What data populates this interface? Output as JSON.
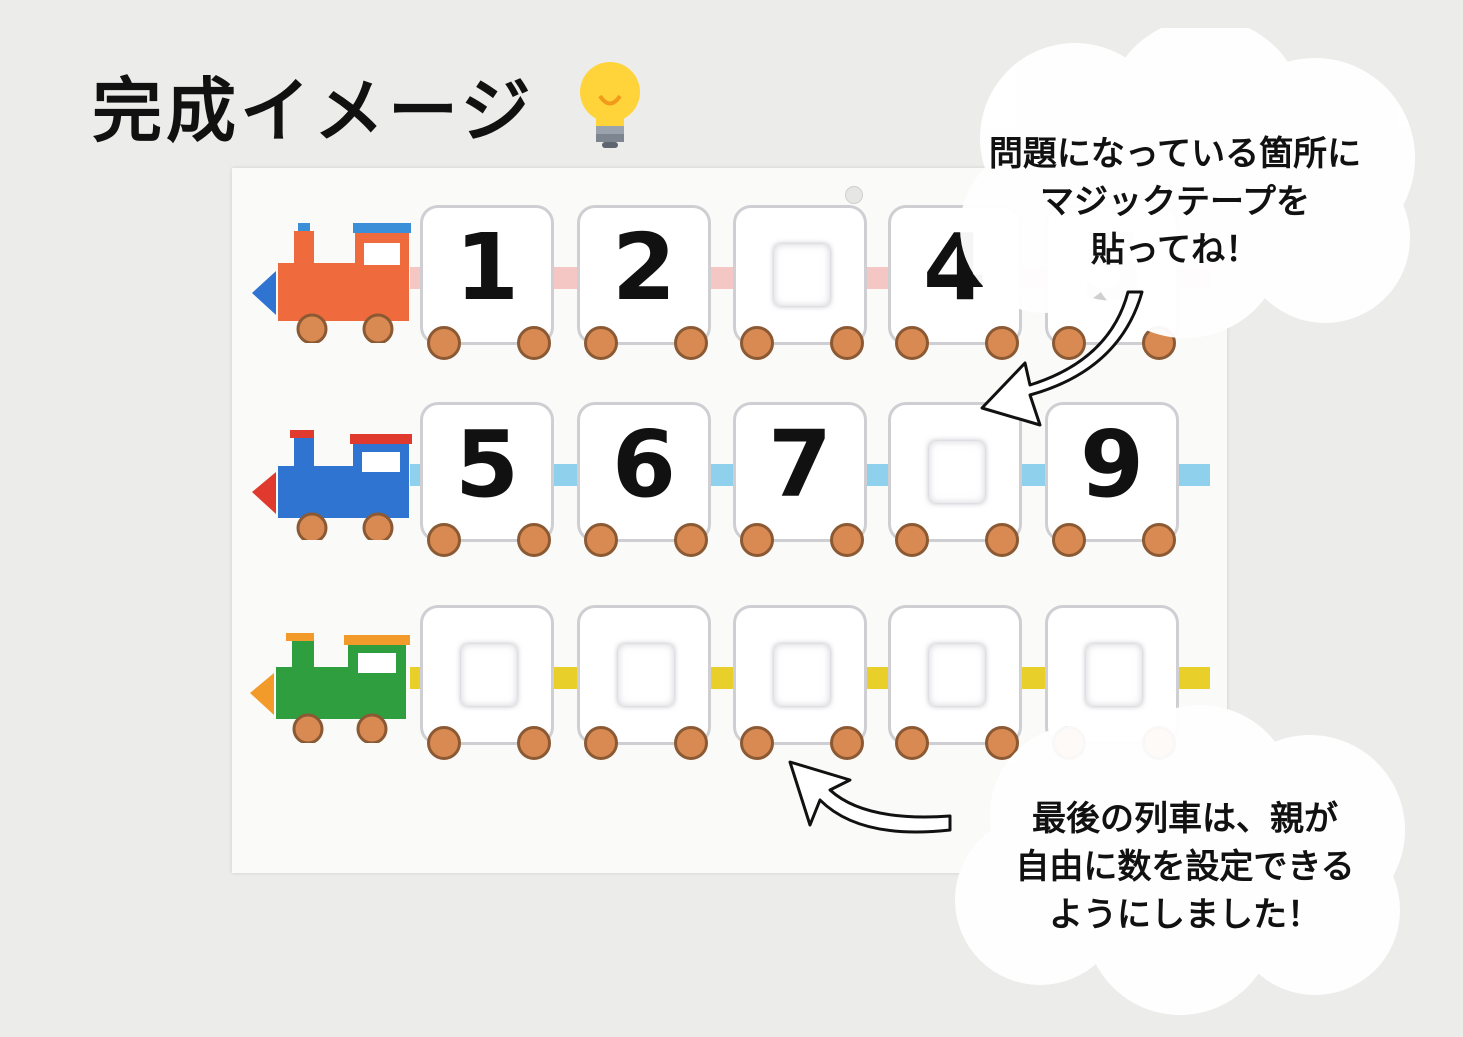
{
  "title": "完成イメージ",
  "title_icon": "lightbulb-icon",
  "rows": [
    {
      "engine_color": "#ef6a3c",
      "connector_color": "#f4c6c4",
      "cars": [
        {
          "number": "1",
          "state": "number"
        },
        {
          "number": "2",
          "state": "number"
        },
        {
          "number": "",
          "state": "velcro"
        },
        {
          "number": "4",
          "state": "number"
        },
        {
          "number": "5",
          "state": "faded"
        }
      ]
    },
    {
      "engine_color": "#2f74d0",
      "connector_color": "#8fd0ec",
      "cars": [
        {
          "number": "5",
          "state": "number"
        },
        {
          "number": "6",
          "state": "number"
        },
        {
          "number": "7",
          "state": "number"
        },
        {
          "number": "",
          "state": "velcro"
        },
        {
          "number": "9",
          "state": "number"
        }
      ]
    },
    {
      "engine_color": "#2e9e3e",
      "connector_color": "#e8cf2a",
      "cars": [
        {
          "number": "",
          "state": "velcro"
        },
        {
          "number": "",
          "state": "velcro"
        },
        {
          "number": "",
          "state": "velcro"
        },
        {
          "number": "",
          "state": "velcro"
        },
        {
          "number": "",
          "state": "velcro"
        }
      ]
    }
  ],
  "callout_top": {
    "lines": [
      "問題になっている箇所に",
      "マジックテープを",
      "貼ってね！"
    ]
  },
  "callout_bottom": {
    "lines": [
      "最後の列車は、親が",
      "自由に数を設定できる",
      "ようにしました！"
    ]
  },
  "colors": {
    "wheel": "#d88a52",
    "car_border": "#cfcfd3"
  }
}
